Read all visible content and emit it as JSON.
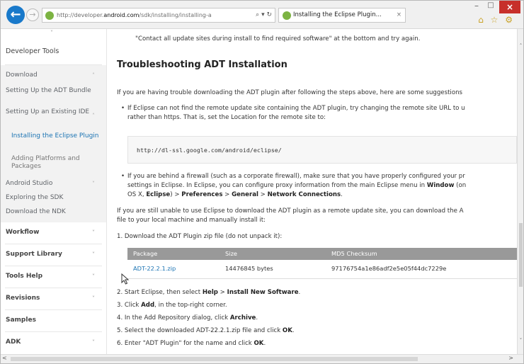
{
  "browser": {
    "url_prefix": "http://developer.",
    "url_domain": "android.com",
    "url_suffix": "/sdk/installing/installing-a",
    "address_tools": "⌕ ▾ ↻",
    "tab_title": "Installing the Eclipse Plugin...",
    "tab_close": "×",
    "back_glyph": "←",
    "forward_glyph": "→",
    "toolbar_glyphs": "⌂ ☆ ⚙",
    "min_glyph": "–",
    "max_glyph": "□",
    "close_glyph": "×"
  },
  "sidebar": {
    "top_chevron": "˅",
    "developer_tools": "Developer Tools",
    "download": "Download",
    "setting_up_bundle": "Setting Up the ADT Bundle",
    "setting_up_existing": "Setting Up an Existing IDE",
    "installing_plugin": "Installing the Eclipse Plugin",
    "adding_platforms": "Adding Platforms and Packages",
    "android_studio": "Android Studio",
    "exploring_sdk": "Exploring the SDK",
    "download_ndk": "Download the NDK",
    "workflow": "Workflow",
    "support_library": "Support Library",
    "tools_help": "Tools Help",
    "revisions": "Revisions",
    "samples": "Samples",
    "adk": "ADK",
    "chev_up": "˄",
    "chev_down": "˅"
  },
  "content": {
    "top_line": "\"Contact all update sites during install to find required software\" at the bottom and try again.",
    "heading": "Troubleshooting ADT Installation",
    "intro": "If you are having trouble downloading the ADT plugin after following the steps above, here are some suggestions",
    "bullet1_line1": "If Eclipse can not find the remote update site containing the ADT plugin, try changing the remote site URL to u",
    "bullet1_line2": "rather than https. That is, set the Location for the remote site to:",
    "code": "http://dl-ssl.google.com/android/eclipse/",
    "bullet2_line1": "If you are behind a firewall (such as a corporate firewall), make sure that you have properly configured your pr",
    "bullet2_line2_pre": "settings in Eclipse. In Eclipse, you can configure proxy information from the main Eclipse menu in ",
    "bullet2_line2_bold": "Window",
    "bullet2_line2_post": " (on",
    "bullet2_line3_pre": "OS X, ",
    "bullet2_line3_b1": "Eclipse",
    "bullet2_line3_sep1": ") > ",
    "bullet2_line3_b2": "Preferences",
    "bullet2_line3_sep2": " > ",
    "bullet2_line3_b3": "General",
    "bullet2_line3_sep3": " > ",
    "bullet2_line3_b4": "Network Connections",
    "bullet2_line3_end": ".",
    "para2_line1": "If you are still unable to use Eclipse to download the ADT plugin as a remote update site, you can download the A",
    "para2_line2": "file to your local machine and manually install it:",
    "step1": "1.  Download the ADT Plugin zip file (do not unpack it):",
    "table_headers": [
      "Package",
      "Size",
      "MD5 Checksum"
    ],
    "table_row": [
      "ADT-22.2.1.zip",
      "14476845 bytes",
      "97176754a1e86adf2e5e05f44dc7229e"
    ],
    "step2_pre": "2.  Start Eclipse, then select ",
    "step2_b1": "Help",
    "step2_sep": " > ",
    "step2_b2": "Install New Software",
    "step2_end": ".",
    "step3_pre": "3.  Click ",
    "step3_b": "Add",
    "step3_post": ", in the top-right corner.",
    "step4_pre": "4.  In the Add Repository dialog, click ",
    "step4_b": "Archive",
    "step4_end": ".",
    "step5_pre": "5.  Select the downloaded ADT-22.2.1.zip file and click ",
    "step5_b": "OK",
    "step5_end": ".",
    "step6_pre": "6.  Enter \"ADT Plugin\" for the name and click ",
    "step6_b": "OK",
    "step6_end": "."
  },
  "scroll": {
    "up": "˄",
    "down": "˅",
    "left": "<",
    "right": ">"
  }
}
